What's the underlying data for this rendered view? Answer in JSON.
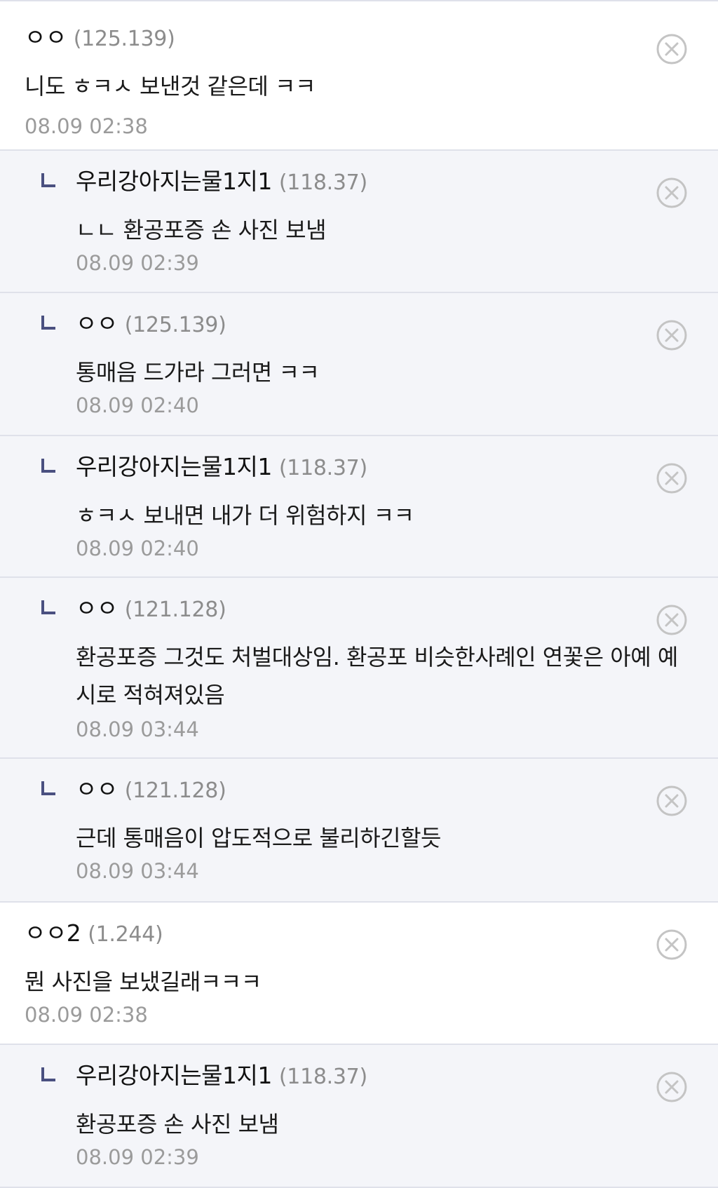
{
  "comments": [
    {
      "type": "top",
      "nickname": "ㅇㅇ",
      "ip": "(125.139)",
      "text": "니도 ㅎㅋㅅ 보낸것 같은데 ㅋㅋ",
      "time": "08.09 02:38"
    },
    {
      "type": "reply",
      "nickname": "우리강아지는물1지1",
      "ip": "(118.37)",
      "text": "ㄴㄴ 환공포증 손 사진 보냄",
      "time": "08.09 02:39"
    },
    {
      "type": "reply",
      "nickname": "ㅇㅇ",
      "ip": "(125.139)",
      "text": "통매음 드가라 그러면 ㅋㅋ",
      "time": "08.09 02:40"
    },
    {
      "type": "reply",
      "nickname": "우리강아지는물1지1",
      "ip": "(118.37)",
      "text": "ㅎㅋㅅ 보내면 내가 더 위험하지 ㅋㅋ",
      "time": "08.09 02:40"
    },
    {
      "type": "reply",
      "nickname": "ㅇㅇ",
      "ip": "(121.128)",
      "text": "환공포증 그것도 처벌대상임. 환공포 비슷한사례인 연꽃은 아예 예시로 적혀져있음",
      "time": "08.09 03:44"
    },
    {
      "type": "reply",
      "nickname": "ㅇㅇ",
      "ip": "(121.128)",
      "text": "근데 통매음이 압도적으로 불리하긴할듯",
      "time": "08.09 03:44"
    },
    {
      "type": "top",
      "nickname": "ㅇㅇ2",
      "ip": "(1.244)",
      "text": "뭔 사진을 보냈길래ㅋㅋㅋ",
      "time": "08.09 02:38"
    },
    {
      "type": "reply",
      "nickname": "우리강아지는물1지1",
      "ip": "(118.37)",
      "text": "환공포증 손 사진 보냄",
      "time": "08.09 02:39"
    }
  ],
  "colors": {
    "reply_background": "#f4f5f9",
    "top_background": "#ffffff",
    "divider": "#dfe1ea",
    "reply_marker": "#4a5080",
    "ip_text": "#8c8c8c",
    "timestamp_text": "#9b9b9b",
    "delete_icon": "#c4c4c4"
  },
  "icons": {
    "reply": "reply-arrow-icon",
    "delete": "close-circle-icon"
  }
}
